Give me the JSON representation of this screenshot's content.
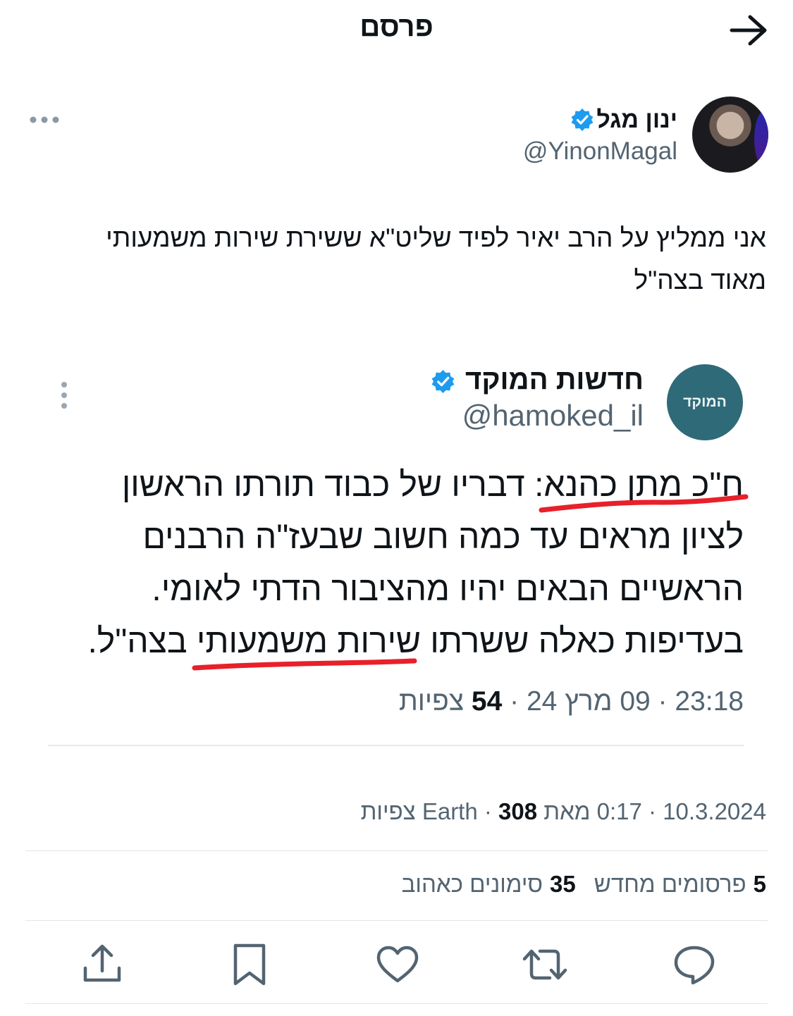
{
  "header": {
    "title": "פרסם",
    "back_icon": "arrow-right-icon"
  },
  "author": {
    "name": "ינון מגל",
    "handle": "@YinonMagal",
    "verified": true,
    "more_icon": "more-horizontal-icon"
  },
  "tweet": {
    "text": "אני ממליץ על הרב יאיר לפיד שליט\"א ששירת שירות משמעותי מאוד בצה\"ל"
  },
  "quoted": {
    "avatar_label": "המוקד",
    "name": "חדשות המוקד",
    "handle": "@hamoked_il",
    "verified": true,
    "more_icon": "more-vertical-icon",
    "lines": [
      "ח\"כ מתן כהנא: דבריו של כבוד תורתו הראשון",
      "לציון מראים עד כמה חשוב שבעז\"ה הרבנים",
      "הראשיים הבאים יהיו מהציבור הדתי לאומי.",
      "בעדיפות כאלה ששרתו שירות משמעותי בצה\"ל."
    ],
    "meta_prefix": "23:18 · 09 מרץ 24 · ",
    "views_count": "54",
    "views_label": "צפיות"
  },
  "meta": {
    "prefix": "10.3.2024 · 0:17 מאת Earth · ",
    "views_count": "308",
    "views_label": "צפיות"
  },
  "stats": {
    "reposts_count": "5",
    "reposts_label": "פרסומים מחדש",
    "likes_count": "35",
    "likes_label": "סימונים כאהוב"
  },
  "actions": {
    "reply_icon": "reply-icon",
    "repost_icon": "repost-icon",
    "like_icon": "heart-icon",
    "bookmark_icon": "bookmark-icon",
    "share_icon": "share-icon"
  },
  "colors": {
    "verified": "#1d9bf0",
    "underline": "#e8202a",
    "secondary_text": "#536471",
    "avatar_quote_bg": "#2f6a79"
  }
}
